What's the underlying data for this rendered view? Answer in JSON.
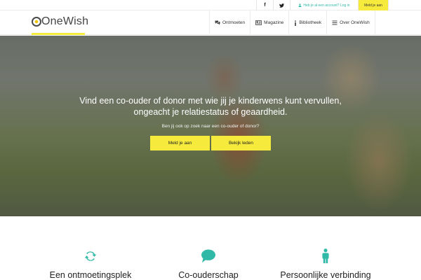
{
  "topbar": {
    "facebook_icon": "f",
    "twitter_icon": "twitter-bird",
    "login_text": "Heb je al een account? Log in",
    "join_label": "Meld je aan"
  },
  "header": {
    "logo_text": "OneWish",
    "nav": [
      {
        "label": "Ontmoeten",
        "icon": "chat-bubbles-icon"
      },
      {
        "label": "Magazine",
        "icon": "newspaper-icon"
      },
      {
        "label": "Bibliotheek",
        "icon": "info-icon"
      },
      {
        "label": "Over OneWish",
        "icon": "list-icon"
      }
    ]
  },
  "hero": {
    "title_line1": "Vind een co-ouder of donor met wie jij je kinderwens kunt vervullen,",
    "title_line2": "ongeacht je relatiestatus of geaardheid.",
    "subtitle": "Ben jij ook op zoek naar een co-ouder of donor?",
    "button_join": "Meld je aan",
    "button_members": "Bekijk leden"
  },
  "features": [
    {
      "label": "Een ontmoetingsplek",
      "icon": "refresh-icon"
    },
    {
      "label": "Co-ouderschap",
      "icon": "speech-bubble-icon"
    },
    {
      "label": "Persoonlijke verbinding",
      "icon": "person-icon"
    }
  ],
  "colors": {
    "accent_yellow": "#f6ea3c",
    "accent_teal": "#2fb9a6"
  }
}
